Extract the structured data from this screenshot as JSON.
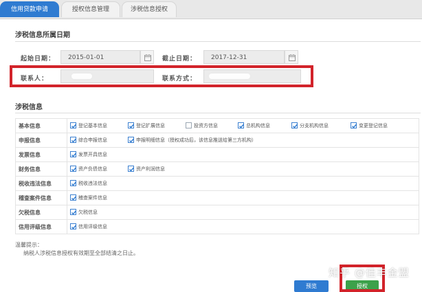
{
  "tabs": [
    {
      "label": "信用贷款申请"
    },
    {
      "label": "授权信息管理"
    },
    {
      "label": "涉税信息授权"
    }
  ],
  "date_section": {
    "title": "涉税信息所属日期",
    "start_label": "起始日期：",
    "start_value": "2015-01-01",
    "end_label": "截止日期：",
    "end_value": "2017-12-31",
    "contact_label": "联系人：",
    "contact_method_label": "联系方式："
  },
  "tax_section": {
    "title": "涉税信息",
    "rows": [
      {
        "label": "基本信息",
        "items": [
          {
            "text": "登记基本信息",
            "checked": true
          },
          {
            "text": "登记扩展信息",
            "checked": true
          },
          {
            "text": "投资方信息",
            "checked": false
          },
          {
            "text": "总机构信息",
            "checked": true
          },
          {
            "text": "分支机构信息",
            "checked": true
          },
          {
            "text": "变更登记信息",
            "checked": true
          }
        ]
      },
      {
        "label": "申报信息",
        "items": [
          {
            "text": "综合申报信息",
            "checked": true
          },
          {
            "text": "申报明细信息（授权成功后，该信息推送给第三方机构）",
            "checked": true
          }
        ]
      },
      {
        "label": "发票信息",
        "items": [
          {
            "text": "发票开具信息",
            "checked": true
          }
        ]
      },
      {
        "label": "财务信息",
        "items": [
          {
            "text": "资产负债信息",
            "checked": true
          },
          {
            "text": "资产利润信息",
            "checked": true
          }
        ]
      },
      {
        "label": "税收违法信息",
        "items": [
          {
            "text": "税收违法信息",
            "checked": true
          }
        ]
      },
      {
        "label": "稽查案件信息",
        "items": [
          {
            "text": "稽查案件信息",
            "checked": true
          }
        ]
      },
      {
        "label": "欠税信息",
        "items": [
          {
            "text": "欠税信息",
            "checked": true
          }
        ]
      },
      {
        "label": "信用评级信息",
        "items": [
          {
            "text": "信用评级信息",
            "checked": true
          }
        ]
      }
    ]
  },
  "tips": {
    "title": "温馨提示：",
    "body": "纳税人涉税信息授权有效期至全部结清之日止。"
  },
  "buttons": {
    "preview": "预览",
    "authorize": "授权"
  },
  "watermark": "知乎 @佳丰金盟",
  "colors": {
    "accent": "#2f7bd1",
    "highlight": "#d2232a",
    "authorize": "#3ca14a"
  }
}
